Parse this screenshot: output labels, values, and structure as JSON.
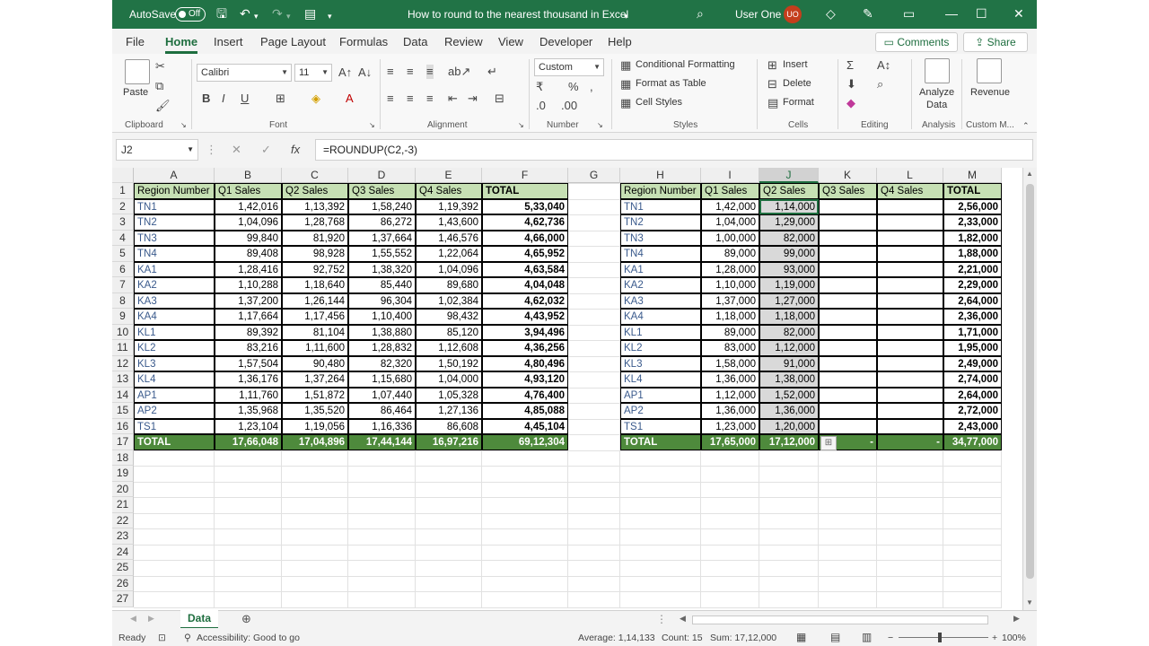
{
  "titlebar": {
    "autosave_label": "AutoSave",
    "autosave_state": "Off",
    "doc_title": "How to round to the nearest thousand in Excel",
    "user_name": "User One",
    "user_initials": "UO"
  },
  "menu": {
    "tabs": [
      "File",
      "Home",
      "Insert",
      "Page Layout",
      "Formulas",
      "Data",
      "Review",
      "View",
      "Developer",
      "Help"
    ],
    "active": "Home",
    "comments_label": "Comments",
    "share_label": "Share"
  },
  "ribbon": {
    "clipboard": {
      "paste": "Paste",
      "group": "Clipboard"
    },
    "font": {
      "name": "Calibri",
      "size": "11",
      "group": "Font"
    },
    "alignment": {
      "group": "Alignment"
    },
    "number": {
      "format": "Custom",
      "group": "Number"
    },
    "styles": {
      "conditional": "Conditional Formatting",
      "table": "Format as Table",
      "cellstyles": "Cell Styles",
      "group": "Styles"
    },
    "cells": {
      "insert": "Insert",
      "delete": "Delete",
      "format": "Format",
      "group": "Cells"
    },
    "editing": {
      "group": "Editing"
    },
    "analysis": {
      "analyze": "Analyze",
      "data": "Data",
      "group": "Analysis"
    },
    "custom": {
      "revenue": "Revenue",
      "group": "Custom M..."
    }
  },
  "formula_bar": {
    "name_box": "J2",
    "formula": "=ROUNDUP(C2,-3)"
  },
  "grid": {
    "columns": [
      "A",
      "B",
      "C",
      "D",
      "E",
      "F",
      "G",
      "H",
      "I",
      "J",
      "K",
      "L",
      "M"
    ],
    "rows": [
      "1",
      "2",
      "3",
      "4",
      "5",
      "6",
      "7",
      "8",
      "9",
      "10",
      "11",
      "12",
      "13",
      "14",
      "15",
      "16",
      "17",
      "18",
      "19",
      "20",
      "21",
      "22",
      "23",
      "24",
      "25",
      "26",
      "27"
    ],
    "left_table": {
      "headers": [
        "Region Number",
        "Q1 Sales",
        "Q2 Sales",
        "Q3 Sales",
        "Q4 Sales",
        "TOTAL"
      ],
      "rows": [
        [
          "TN1",
          "1,42,016",
          "1,13,392",
          "1,58,240",
          "1,19,392",
          "5,33,040"
        ],
        [
          "TN2",
          "1,04,096",
          "1,28,768",
          "86,272",
          "1,43,600",
          "4,62,736"
        ],
        [
          "TN3",
          "99,840",
          "81,920",
          "1,37,664",
          "1,46,576",
          "4,66,000"
        ],
        [
          "TN4",
          "89,408",
          "98,928",
          "1,55,552",
          "1,22,064",
          "4,65,952"
        ],
        [
          "KA1",
          "1,28,416",
          "92,752",
          "1,38,320",
          "1,04,096",
          "4,63,584"
        ],
        [
          "KA2",
          "1,10,288",
          "1,18,640",
          "85,440",
          "89,680",
          "4,04,048"
        ],
        [
          "KA3",
          "1,37,200",
          "1,26,144",
          "96,304",
          "1,02,384",
          "4,62,032"
        ],
        [
          "KA4",
          "1,17,664",
          "1,17,456",
          "1,10,400",
          "98,432",
          "4,43,952"
        ],
        [
          "KL1",
          "89,392",
          "81,104",
          "1,38,880",
          "85,120",
          "3,94,496"
        ],
        [
          "KL2",
          "83,216",
          "1,11,600",
          "1,28,832",
          "1,12,608",
          "4,36,256"
        ],
        [
          "KL3",
          "1,57,504",
          "90,480",
          "82,320",
          "1,50,192",
          "4,80,496"
        ],
        [
          "KL4",
          "1,36,176",
          "1,37,264",
          "1,15,680",
          "1,04,000",
          "4,93,120"
        ],
        [
          "AP1",
          "1,11,760",
          "1,51,872",
          "1,07,440",
          "1,05,328",
          "4,76,400"
        ],
        [
          "AP2",
          "1,35,968",
          "1,35,520",
          "86,464",
          "1,27,136",
          "4,85,088"
        ],
        [
          "TS1",
          "1,23,104",
          "1,19,056",
          "1,16,336",
          "86,608",
          "4,45,104"
        ]
      ],
      "total": [
        "TOTAL",
        "17,66,048",
        "17,04,896",
        "17,44,144",
        "16,97,216",
        "69,12,304"
      ]
    },
    "right_table": {
      "headers": [
        "Region Number",
        "Q1 Sales",
        "Q2 Sales",
        "Q3 Sales",
        "Q4 Sales",
        "TOTAL"
      ],
      "rows": [
        [
          "TN1",
          "1,42,000",
          "1,14,000",
          "",
          "",
          "2,56,000"
        ],
        [
          "TN2",
          "1,04,000",
          "1,29,000",
          "",
          "",
          "2,33,000"
        ],
        [
          "TN3",
          "1,00,000",
          "82,000",
          "",
          "",
          "1,82,000"
        ],
        [
          "TN4",
          "89,000",
          "99,000",
          "",
          "",
          "1,88,000"
        ],
        [
          "KA1",
          "1,28,000",
          "93,000",
          "",
          "",
          "2,21,000"
        ],
        [
          "KA2",
          "1,10,000",
          "1,19,000",
          "",
          "",
          "2,29,000"
        ],
        [
          "KA3",
          "1,37,000",
          "1,27,000",
          "",
          "",
          "2,64,000"
        ],
        [
          "KA4",
          "1,18,000",
          "1,18,000",
          "",
          "",
          "2,36,000"
        ],
        [
          "KL1",
          "89,000",
          "82,000",
          "",
          "",
          "1,71,000"
        ],
        [
          "KL2",
          "83,000",
          "1,12,000",
          "",
          "",
          "1,95,000"
        ],
        [
          "KL3",
          "1,58,000",
          "91,000",
          "",
          "",
          "2,49,000"
        ],
        [
          "KL4",
          "1,36,000",
          "1,38,000",
          "",
          "",
          "2,74,000"
        ],
        [
          "AP1",
          "1,12,000",
          "1,52,000",
          "",
          "",
          "2,64,000"
        ],
        [
          "AP2",
          "1,36,000",
          "1,36,000",
          "",
          "",
          "2,72,000"
        ],
        [
          "TS1",
          "1,23,000",
          "1,20,000",
          "",
          "",
          "2,43,000"
        ]
      ],
      "total": [
        "TOTAL",
        "17,65,000",
        "17,12,000",
        "-",
        "-",
        "34,77,000"
      ]
    }
  },
  "sheets": {
    "active": "Data"
  },
  "status": {
    "ready": "Ready",
    "accessibility": "Accessibility: Good to go",
    "average": "Average: 1,14,133",
    "count": "Count: 15",
    "sum": "Sum: 17,12,000",
    "zoom": "100%"
  }
}
